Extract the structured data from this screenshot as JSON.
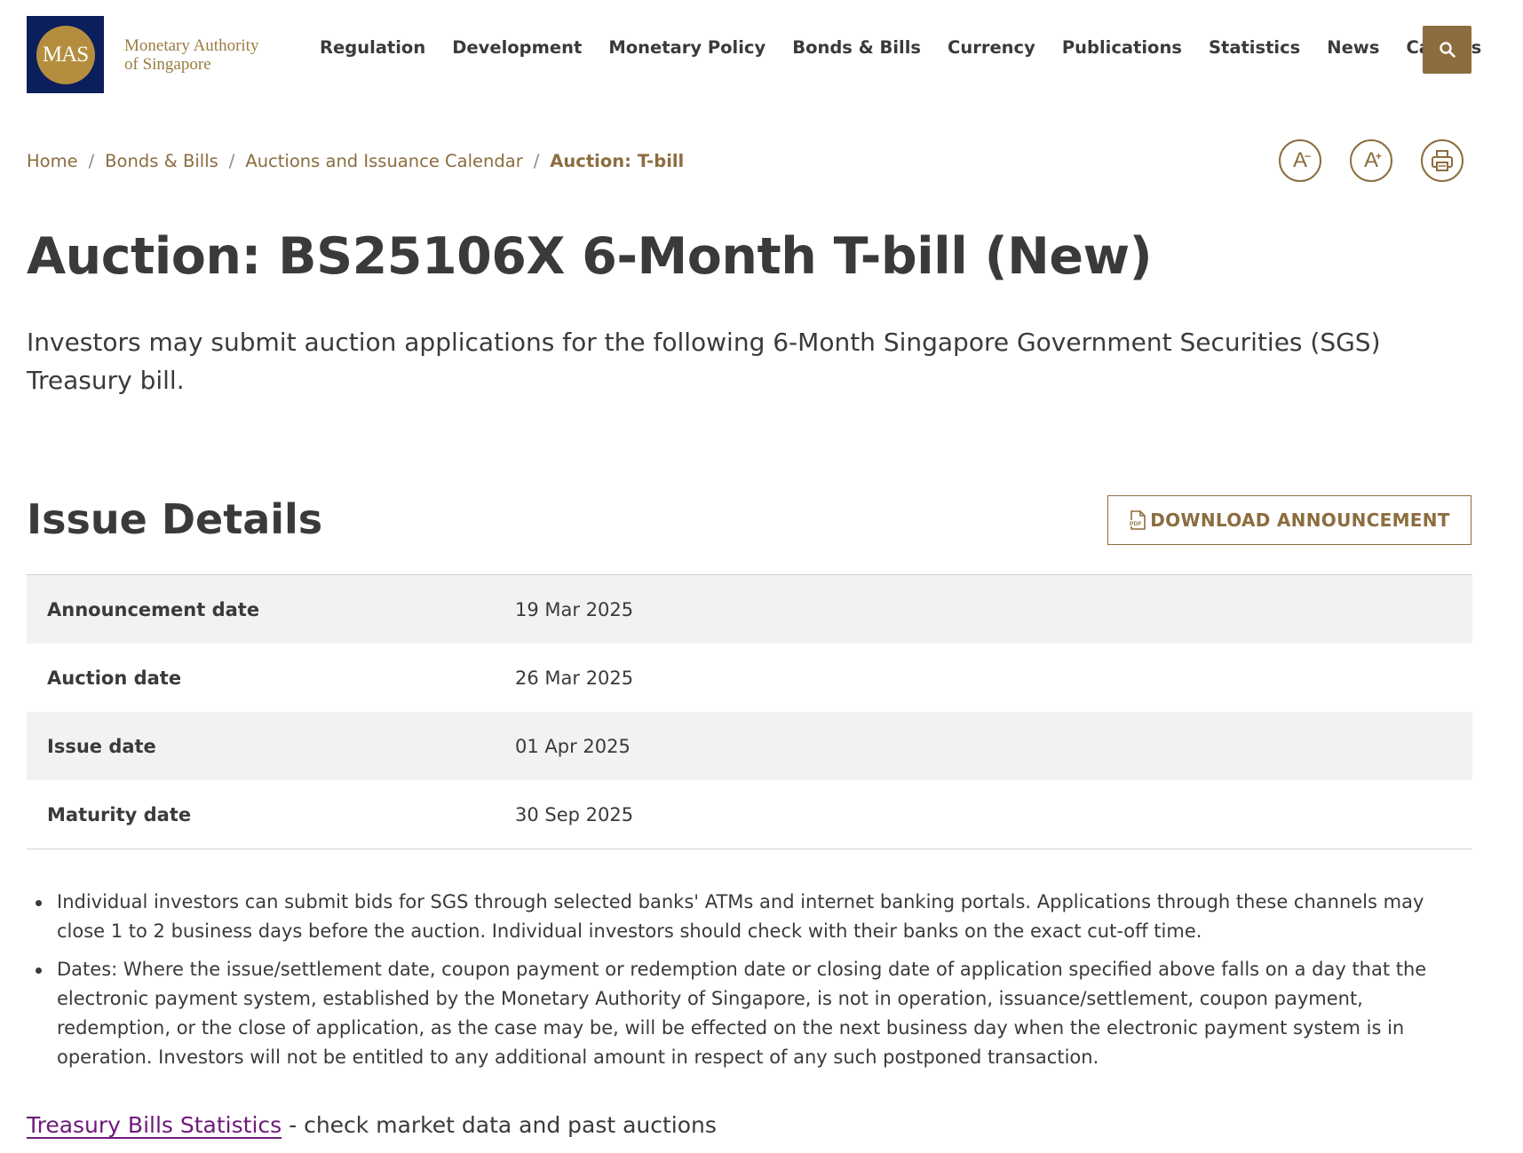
{
  "logo": {
    "mark": "MAS",
    "line1": "Monetary Authority",
    "line2": "of Singapore"
  },
  "nav": [
    "Regulation",
    "Development",
    "Monetary Policy",
    "Bonds & Bills",
    "Currency",
    "Publications",
    "Statistics",
    "News",
    "Careers"
  ],
  "search": {
    "icon": "search-icon"
  },
  "breadcrumb": {
    "items": [
      "Home",
      "Bonds & Bills",
      "Auctions and Issuance Calendar"
    ],
    "current": "Auction: T-bill",
    "separator": "/"
  },
  "tools": {
    "decrease_label": "A",
    "decrease_mark": "−",
    "increase_label": "A",
    "increase_mark": "+",
    "print_icon": "printer-icon"
  },
  "page": {
    "title": "Auction: BS25106X 6-Month T-bill (New)",
    "intro": "Investors may submit auction applications for the following 6-Month Singapore Government Securities (SGS) Treasury bill."
  },
  "issue": {
    "heading": "Issue Details",
    "download_label": "DOWNLOAD ANNOUNCEMENT",
    "download_icon": "pdf-icon",
    "rows": [
      {
        "label": "Announcement date",
        "value": "19 Mar 2025"
      },
      {
        "label": "Auction date",
        "value": "26 Mar 2025"
      },
      {
        "label": "Issue date",
        "value": "01 Apr 2025"
      },
      {
        "label": "Maturity date",
        "value": "30 Sep 2025"
      }
    ]
  },
  "notes": [
    "Individual investors can submit bids for SGS through selected banks' ATMs and internet banking portals. Applications through these channels may close 1 to 2 business days before the auction. Individual investors should check with their banks on the exact cut-off time.",
    "Dates: Where the issue/settlement date, coupon payment or redemption date or closing date of application specified above falls on a day that the electronic payment system, established by the Monetary Authority of Singapore, is not in operation, issuance/settlement, coupon payment, redemption, or the close of application, as the case may be, will be effected on the next business day when the electronic payment system is in operation. Investors will not be entitled to any additional amount in respect of any such postponed transaction."
  ],
  "stats": {
    "link": "Treasury Bills Statistics",
    "suffix": " - check market data and past auctions"
  },
  "colors": {
    "brand_gold": "#8c6d3f",
    "logo_navy": "#0b1f5c",
    "link_purple": "#6e1a7a",
    "row_alt": "#f2f2f2"
  }
}
